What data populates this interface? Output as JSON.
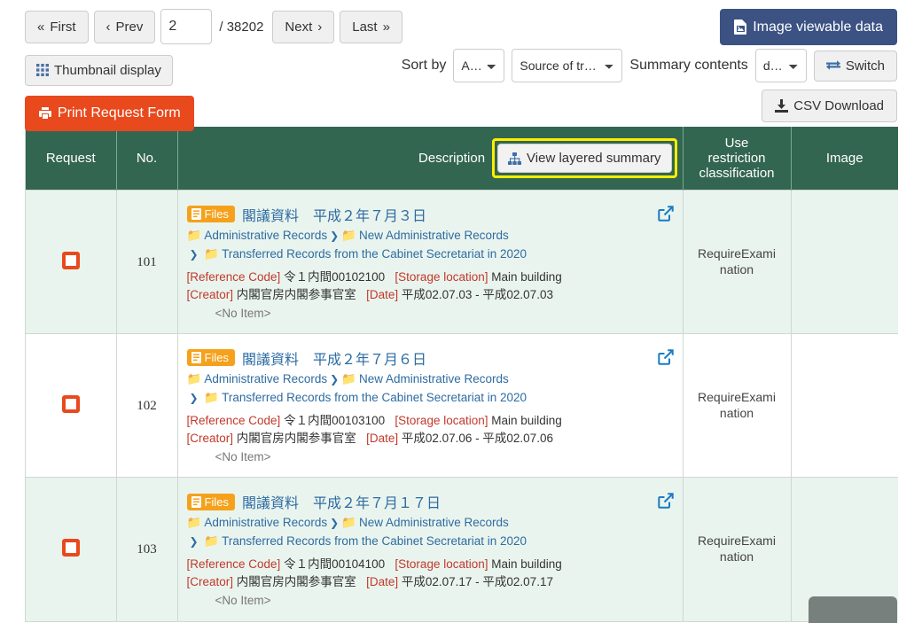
{
  "toolbar": {
    "pager": {
      "first_label": "First",
      "prev_label": "Prev",
      "next_label": "Next",
      "last_label": "Last",
      "page_value": "2",
      "total_label": "/ 38202",
      "page_placeholder": ""
    },
    "thumbnail_label": "Thumbnail display",
    "print_label": "Print Request Form",
    "image_viewable_label": "Image viewable data",
    "sort_by_label": "Sort by",
    "sort_order_value": "Asc⋯",
    "sort_field_value": "Source of tra⋯",
    "summary_contents_label": "Summary contents",
    "summary_contents_value": "def⋯",
    "switch_label": "Switch",
    "csv_label": "CSV Download"
  },
  "table": {
    "headers": {
      "request": "Request",
      "no": "No.",
      "description": "Description",
      "view_layered_summary": "View layered summary",
      "use_restriction": "Use\nrestriction\nclassification",
      "use_restriction_l1": "Use",
      "use_restriction_l2": "restriction",
      "use_restriction_l3": "classification",
      "image": "Image"
    },
    "rows": [
      {
        "no": "101",
        "badge": "Files",
        "title": "閣議資料　平成２年７月３日",
        "crumb1": "Administrative Records",
        "crumb2": "New Administrative Records",
        "crumb3": "Transferred Records from the Cabinet Secretariat in 2020",
        "ref_code_key": "[Reference Code]",
        "ref_code_value": "令１内間00102100",
        "storage_key": "[Storage location]",
        "storage_value": "Main building",
        "creator_key": "[Creator]",
        "creator_value": "内閣官房内閣参事官室",
        "date_key": "[Date]",
        "date_value": "平成02.07.03 - 平成02.07.03",
        "no_item": "<No Item>",
        "use_restriction_l1": "RequireExami",
        "use_restriction_l2": "nation",
        "image": ""
      },
      {
        "no": "102",
        "badge": "Files",
        "title": "閣議資料　平成２年７月６日",
        "crumb1": "Administrative Records",
        "crumb2": "New Administrative Records",
        "crumb3": "Transferred Records from the Cabinet Secretariat in 2020",
        "ref_code_key": "[Reference Code]",
        "ref_code_value": "令１内間00103100",
        "storage_key": "[Storage location]",
        "storage_value": "Main building",
        "creator_key": "[Creator]",
        "creator_value": "内閣官房内閣参事官室",
        "date_key": "[Date]",
        "date_value": "平成02.07.06 - 平成02.07.06",
        "no_item": "<No Item>",
        "use_restriction_l1": "RequireExami",
        "use_restriction_l2": "nation",
        "image": ""
      },
      {
        "no": "103",
        "badge": "Files",
        "title": "閣議資料　平成２年７月１７日",
        "crumb1": "Administrative Records",
        "crumb2": "New Administrative Records",
        "crumb3": "Transferred Records from the Cabinet Secretariat in 2020",
        "ref_code_key": "[Reference Code]",
        "ref_code_value": "令１内間00104100",
        "storage_key": "[Storage location]",
        "storage_value": "Main building",
        "creator_key": "[Creator]",
        "creator_value": "内閣官房内閣参事官室",
        "date_key": "[Date]",
        "date_value": "平成02.07.17 - 平成02.07.17",
        "no_item": "<No Item>",
        "use_restriction_l1": "RequireExami",
        "use_restriction_l2": "nation",
        "image": ""
      }
    ]
  },
  "colors": {
    "header_green": "#336650",
    "row_alt_green": "#eaf4ee",
    "orange": "#e8491d",
    "navy": "#3b5283",
    "badge_orange": "#f5a11b",
    "link_blue": "#2d6ca2",
    "highlight_yellow": "#ffee00"
  },
  "icons": {
    "first": "«",
    "prev": "‹",
    "next": "›",
    "last": "»"
  }
}
